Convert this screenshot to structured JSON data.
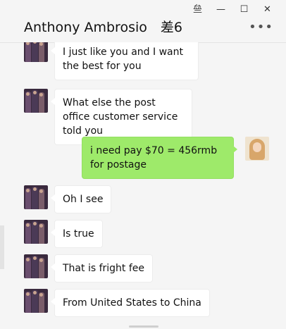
{
  "window": {
    "controls": [
      "pin-icon",
      "minimize-icon",
      "maximize-icon",
      "close-icon"
    ],
    "control_glyphs": [
      "亝",
      "—",
      "☐",
      "✕"
    ]
  },
  "header": {
    "title": "Anthony Ambrosio　差6",
    "more": "•••"
  },
  "colors": {
    "background": "#f5f5f5",
    "bubble_in": "#ffffff",
    "bubble_out": "#9eea6a"
  },
  "messages": [
    {
      "side": "in",
      "text": "I just like you and I want the best for you"
    },
    {
      "side": "in",
      "text": "What else the post office customer service told you"
    },
    {
      "side": "out",
      "text": "i need pay $70 = 456rmb for postage"
    },
    {
      "side": "in",
      "text": "Oh I see"
    },
    {
      "side": "in",
      "text": "Is true"
    },
    {
      "side": "in",
      "text": "That is fright fee"
    },
    {
      "side": "in",
      "text": "From United States to China"
    }
  ]
}
